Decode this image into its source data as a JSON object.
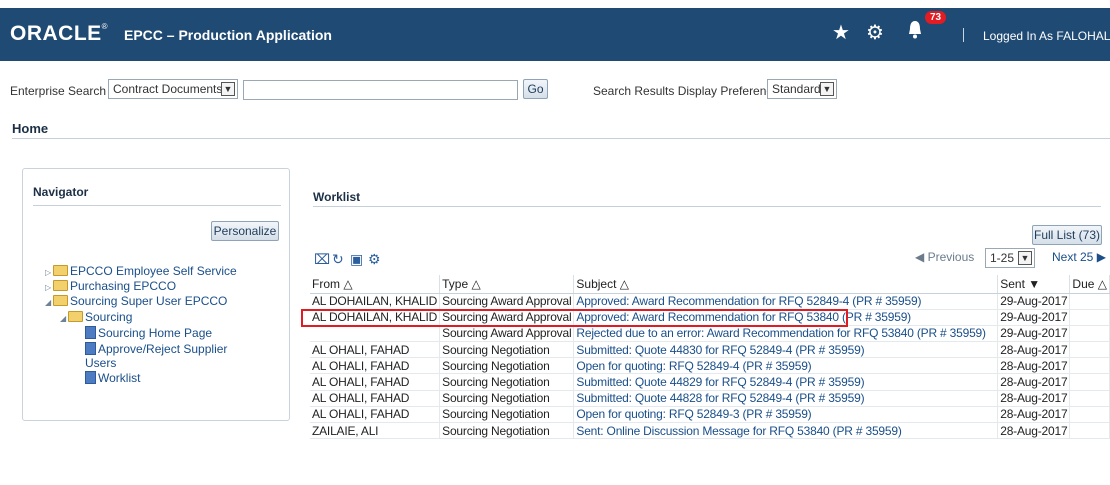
{
  "header": {
    "logo": "ORACLE",
    "app_title": "EPCC – Production Application",
    "notification_count": "73",
    "logged_in": "Logged In As FALOHALI"
  },
  "search": {
    "label": "Enterprise Search",
    "category": "Contract Documents",
    "query": "",
    "go_label": "Go",
    "pref_label": "Search Results Display Preference",
    "pref_value": "Standard"
  },
  "page_title": "Home",
  "navigator": {
    "title": "Navigator",
    "personalize_label": "Personalize",
    "items": [
      "EPCCO Employee Self Service",
      "Purchasing EPCCO",
      "Sourcing Super User EPCCO",
      "Sourcing",
      "Sourcing Home Page",
      "Approve/Reject Supplier",
      "Users",
      "Worklist"
    ]
  },
  "worklist": {
    "title": "Worklist",
    "full_list_label": "Full List (73)",
    "pager": {
      "previous": "Previous",
      "range": "1-25",
      "next": "Next 25"
    },
    "columns": [
      "From",
      "Type",
      "Subject",
      "Sent",
      "Due"
    ],
    "rows": [
      [
        "AL DOHAILAN, KHALID",
        "Sourcing Award Approval",
        "Approved: Award Recommendation for RFQ 52849-4 (PR # 35959)",
        "29-Aug-2017",
        ""
      ],
      [
        "AL DOHAILAN, KHALID",
        "Sourcing Award Approval",
        "Approved: Award Recommendation for RFQ 53840 (PR # 35959)",
        "29-Aug-2017",
        ""
      ],
      [
        "",
        "Sourcing Award Approval",
        "Rejected due to an error: Award Recommendation for RFQ 53840 (PR # 35959)",
        "29-Aug-2017",
        ""
      ],
      [
        "AL OHALI, FAHAD",
        "Sourcing Negotiation",
        "Submitted: Quote 44830 for RFQ 52849-4 (PR # 35959)",
        "28-Aug-2017",
        ""
      ],
      [
        "AL OHALI, FAHAD",
        "Sourcing Negotiation",
        "Open for quoting: RFQ 52849-4 (PR # 35959)",
        "28-Aug-2017",
        ""
      ],
      [
        "AL OHALI, FAHAD",
        "Sourcing Negotiation",
        "Submitted: Quote 44829 for RFQ 52849-4 (PR # 35959)",
        "28-Aug-2017",
        ""
      ],
      [
        "AL OHALI, FAHAD",
        "Sourcing Negotiation",
        "Submitted: Quote 44828 for RFQ 52849-4 (PR # 35959)",
        "28-Aug-2017",
        ""
      ],
      [
        "AL OHALI, FAHAD",
        "Sourcing Negotiation",
        "Open for quoting: RFQ 52849-3 (PR # 35959)",
        "28-Aug-2017",
        ""
      ],
      [
        "ZAILAIE, ALI",
        "Sourcing Negotiation",
        "Sent: Online Discussion Message for RFQ 53840 (PR # 35959)",
        "28-Aug-2017",
        ""
      ]
    ]
  },
  "colors": {
    "header_bg": "#1f4a73",
    "link": "#1a4f8a",
    "highlight_box": "#e01b24",
    "badge": "#e31c23"
  }
}
